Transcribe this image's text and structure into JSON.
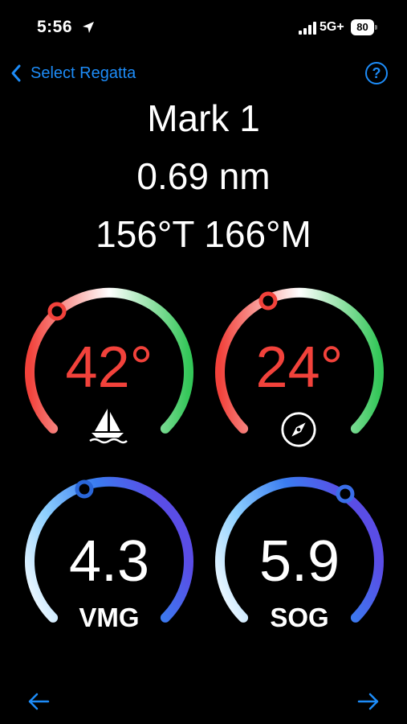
{
  "status_bar": {
    "time": "5:56",
    "network": "5G+",
    "battery": "80"
  },
  "nav": {
    "back_label": "Select Regatta",
    "help_label": "?"
  },
  "mark": {
    "title": "Mark 1",
    "distance": "0.69 nm",
    "bearing": "156°T 166°M"
  },
  "gauges": {
    "wind_angle": {
      "value": "42°",
      "icon": "sailboat-icon"
    },
    "heading_angle": {
      "value": "24°",
      "icon": "compass-icon"
    },
    "vmg": {
      "value": "4.3",
      "label": "VMG"
    },
    "sog": {
      "value": "5.9",
      "label": "SOG"
    }
  },
  "colors": {
    "accent": "#1d8cf8",
    "red": "#f2423b",
    "green": "#34c759",
    "blue_light": "#8ed0ff",
    "blue": "#3a7cf0",
    "purple": "#5a4de6"
  }
}
